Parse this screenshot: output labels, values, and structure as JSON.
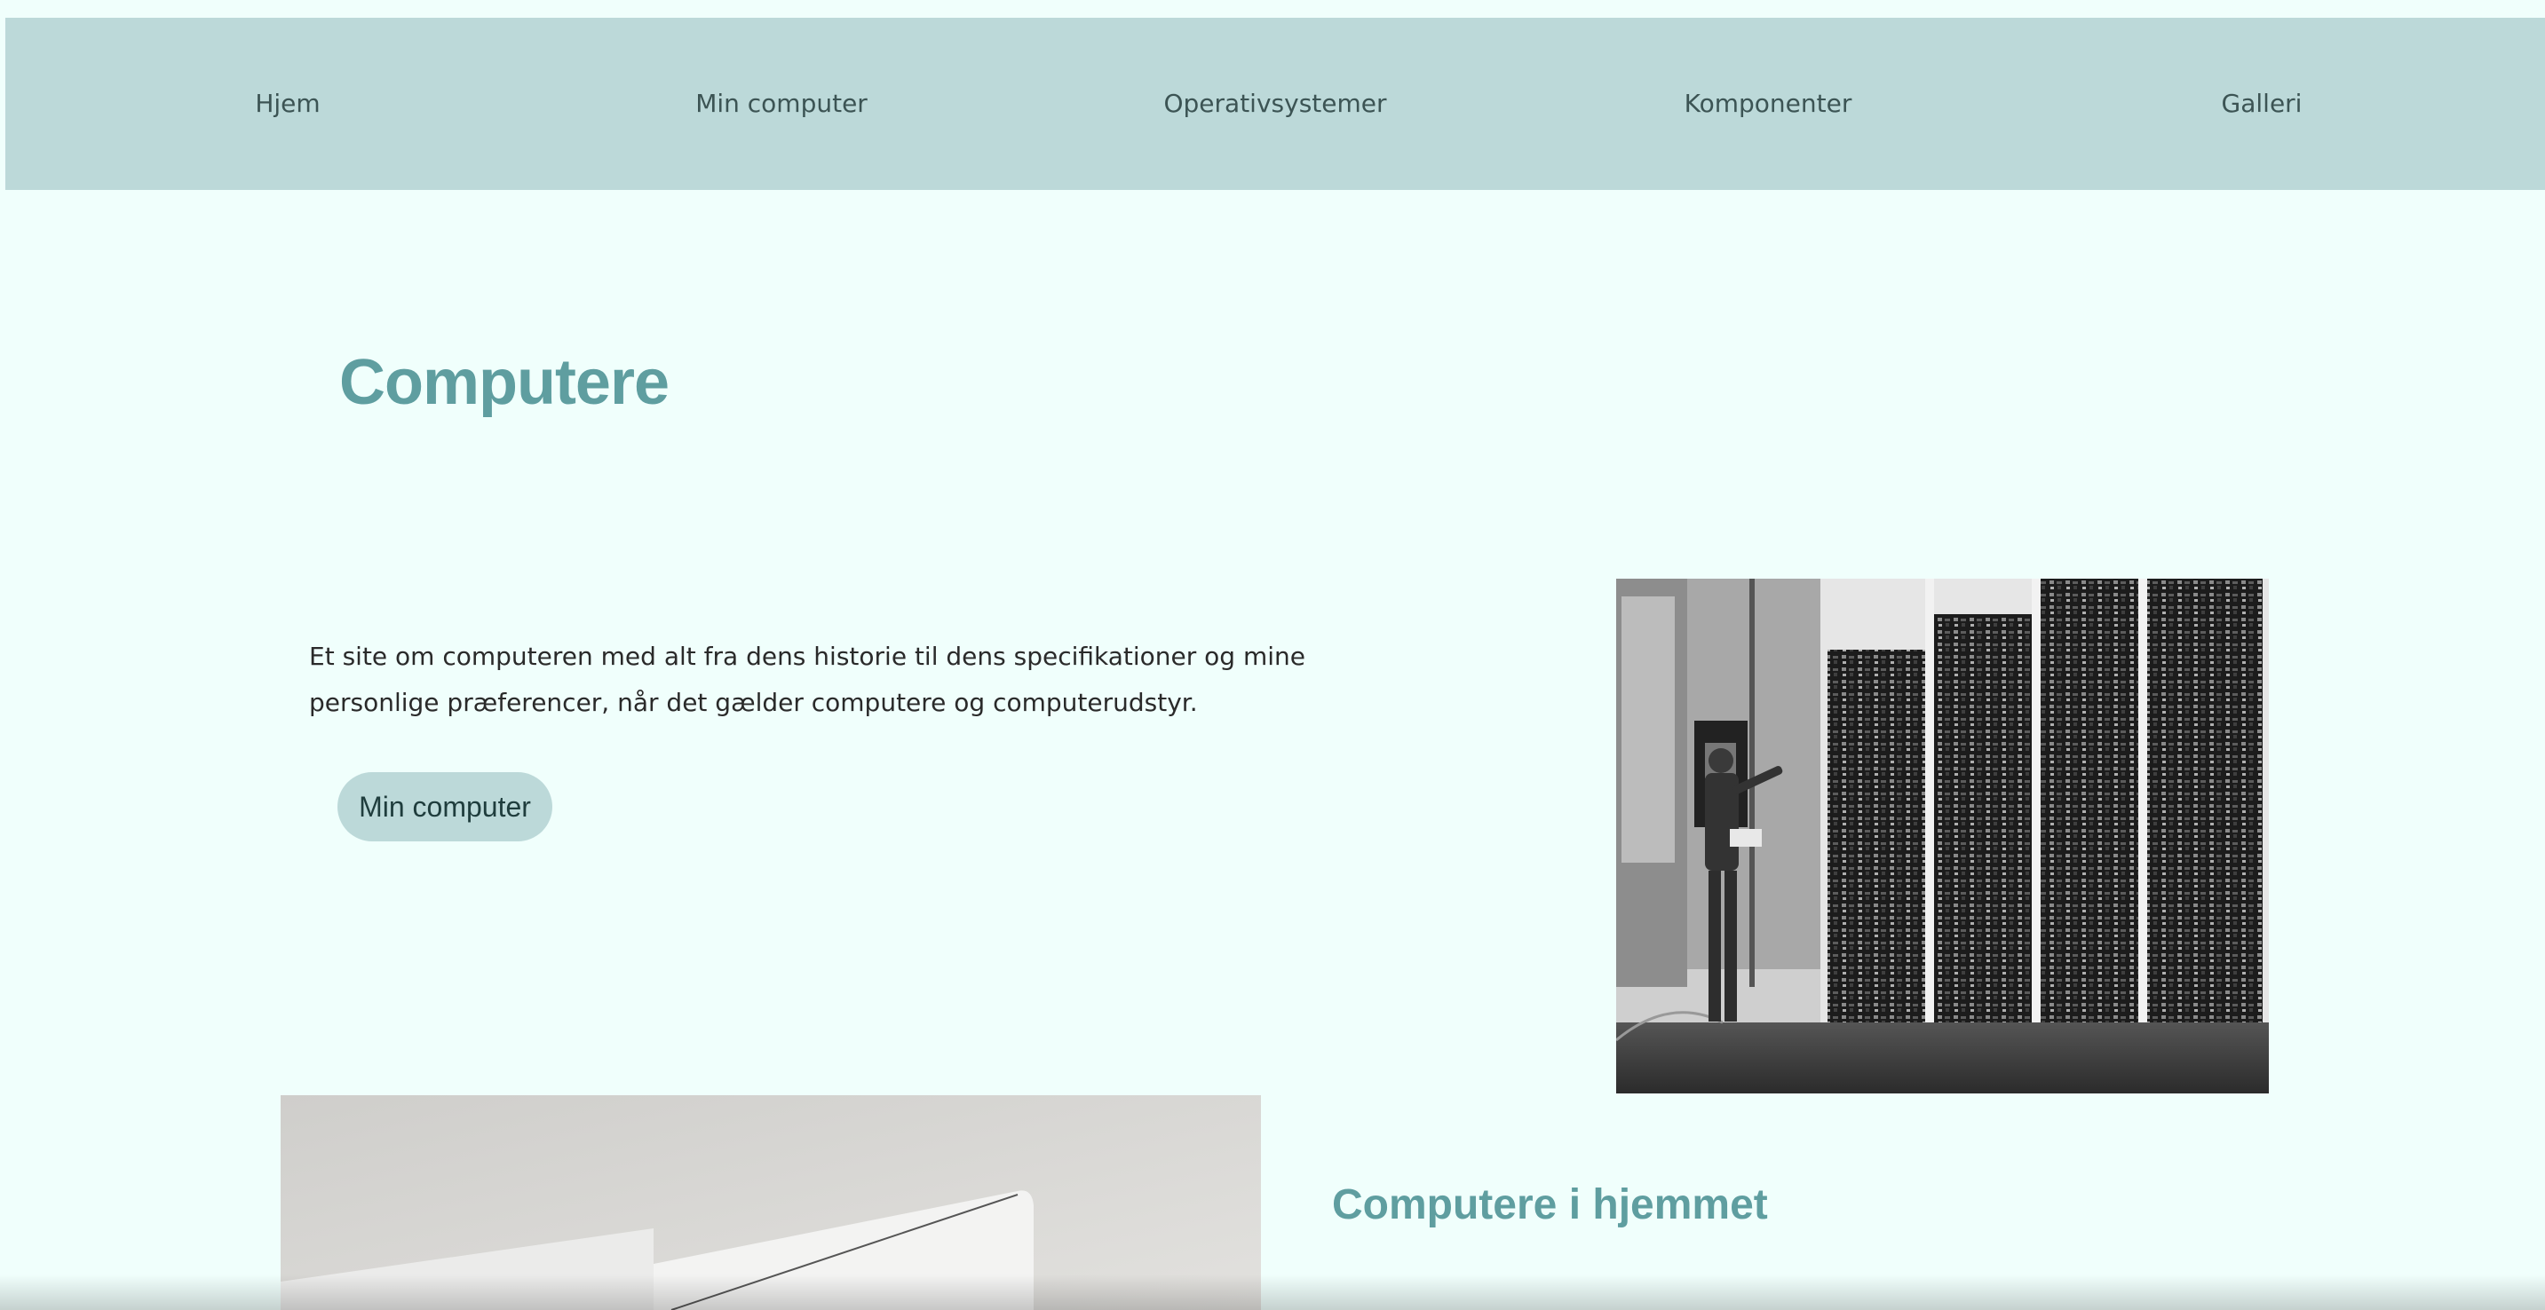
{
  "nav": {
    "items": [
      {
        "label": "Hjem"
      },
      {
        "label": "Min computer"
      },
      {
        "label": "Operativsystemer"
      },
      {
        "label": "Komponenter"
      },
      {
        "label": "Galleri"
      }
    ]
  },
  "hero": {
    "title": "Computere",
    "intro": "Et site om computeren med alt fra dens historie til dens specifikationer og mine personlige præferencer, når det gælder computere og computerudstyr.",
    "button_label": "Min computer"
  },
  "section2": {
    "heading": "Computere i hjemmet"
  },
  "colors": {
    "background": "#f0fffc",
    "nav_background": "#bcd9d9",
    "accent": "#5f9ea0",
    "text": "#2a2a2a"
  }
}
